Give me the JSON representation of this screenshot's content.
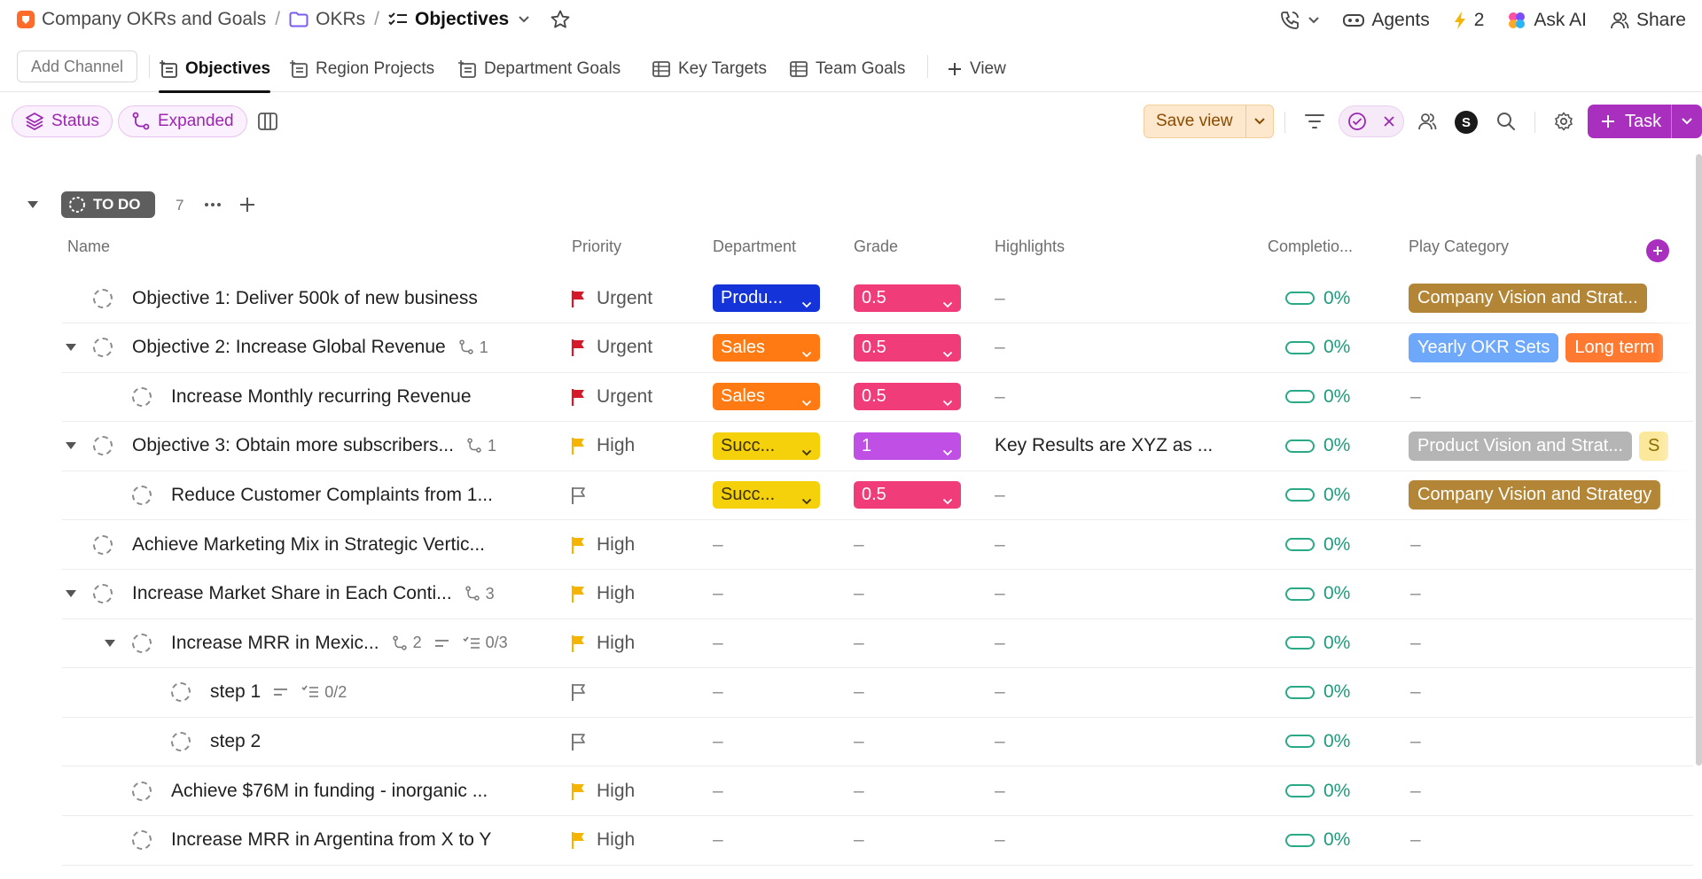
{
  "breadcrumb": {
    "workspace": "Company OKRs and Goals",
    "folder": "OKRs",
    "list": "Objectives"
  },
  "top_actions": {
    "agents": "Agents",
    "automations_count": "2",
    "ask_ai": "Ask AI",
    "share": "Share"
  },
  "views": {
    "add_channel": "Add Channel",
    "tabs": [
      "Objectives",
      "Region Projects",
      "Department Goals",
      "Key Targets",
      "Team Goals"
    ],
    "add_view": "View"
  },
  "toolbar": {
    "status": "Status",
    "expanded": "Expanded",
    "save_view": "Save view",
    "assignee_avatar": "S",
    "task": "Task"
  },
  "group": {
    "status": "TO DO",
    "count": "7"
  },
  "columns": [
    "Name",
    "Priority",
    "Department",
    "Grade",
    "Highlights",
    "Completio...",
    "Play Category"
  ],
  "colors": {
    "accent": "#a92fbf",
    "urgent_flag": "#d3192a",
    "high_flag": "#f5b400",
    "dept_product": "#1434d9",
    "dept_sales": "#ff7a12",
    "dept_success": "#f4d10a",
    "grade_half": "#f03c78",
    "grade_one": "#c04fe6",
    "completion": "#2aa986"
  },
  "rows": [
    {
      "name": "Objective 1: Deliver 500k of new business",
      "priority": "Urgent",
      "department": "Produ...",
      "grade": "0.5",
      "highlights": "–",
      "completion": "0%",
      "play": [
        "Company Vision and Strat..."
      ]
    },
    {
      "name": "Objective 2: Increase Global Revenue",
      "subtasks": "1",
      "priority": "Urgent",
      "department": "Sales",
      "grade": "0.5",
      "highlights": "–",
      "completion": "0%",
      "play": [
        "Yearly OKR Sets",
        "Long term"
      ]
    },
    {
      "name": "Increase Monthly recurring Revenue",
      "priority": "Urgent",
      "department": "Sales",
      "grade": "0.5",
      "highlights": "–",
      "completion": "0%",
      "play_empty": "–"
    },
    {
      "name": "Objective 3: Obtain more subscribers...",
      "subtasks": "1",
      "priority": "High",
      "department": "Succ...",
      "grade": "1",
      "highlights": "Key Results are XYZ as ...",
      "completion": "0%",
      "play": [
        "Product Vision and Strat...",
        "S"
      ]
    },
    {
      "name": "Reduce Customer Complaints from 1...",
      "priority": "",
      "department": "Succ...",
      "grade": "0.5",
      "highlights": "–",
      "completion": "0%",
      "play": [
        "Company Vision and Strategy"
      ]
    },
    {
      "name": "Achieve Marketing Mix in Strategic Vertic...",
      "priority": "High",
      "department_empty": "–",
      "grade_empty": "–",
      "highlights": "–",
      "completion": "0%",
      "play_empty": "–"
    },
    {
      "name": "Increase Market Share in Each Conti...",
      "subtasks": "3",
      "priority": "High",
      "department_empty": "–",
      "grade_empty": "–",
      "highlights": "–",
      "completion": "0%",
      "play_empty": "–"
    },
    {
      "name": "Increase MRR in Mexic...",
      "subtasks": "2",
      "checklist": "0/3",
      "priority": "High",
      "department_empty": "–",
      "grade_empty": "–",
      "highlights": "–",
      "completion": "0%",
      "play_empty": "–"
    },
    {
      "name": "step 1",
      "checklist": "0/2",
      "priority": "",
      "department_empty": "–",
      "grade_empty": "–",
      "highlights": "–",
      "completion": "0%",
      "play_empty": "–"
    },
    {
      "name": "step 2",
      "priority": "",
      "department_empty": "–",
      "grade_empty": "–",
      "highlights": "–",
      "completion": "0%",
      "play_empty": "–"
    },
    {
      "name": "Achieve $76M in funding - inorganic ...",
      "priority": "High",
      "department_empty": "–",
      "grade_empty": "–",
      "highlights": "–",
      "completion": "0%",
      "play_empty": "–"
    },
    {
      "name": "Increase MRR in Argentina from X to Y",
      "priority": "High",
      "department_empty": "–",
      "grade_empty": "–",
      "highlights": "–",
      "completion": "0%",
      "play_empty": "–"
    }
  ]
}
